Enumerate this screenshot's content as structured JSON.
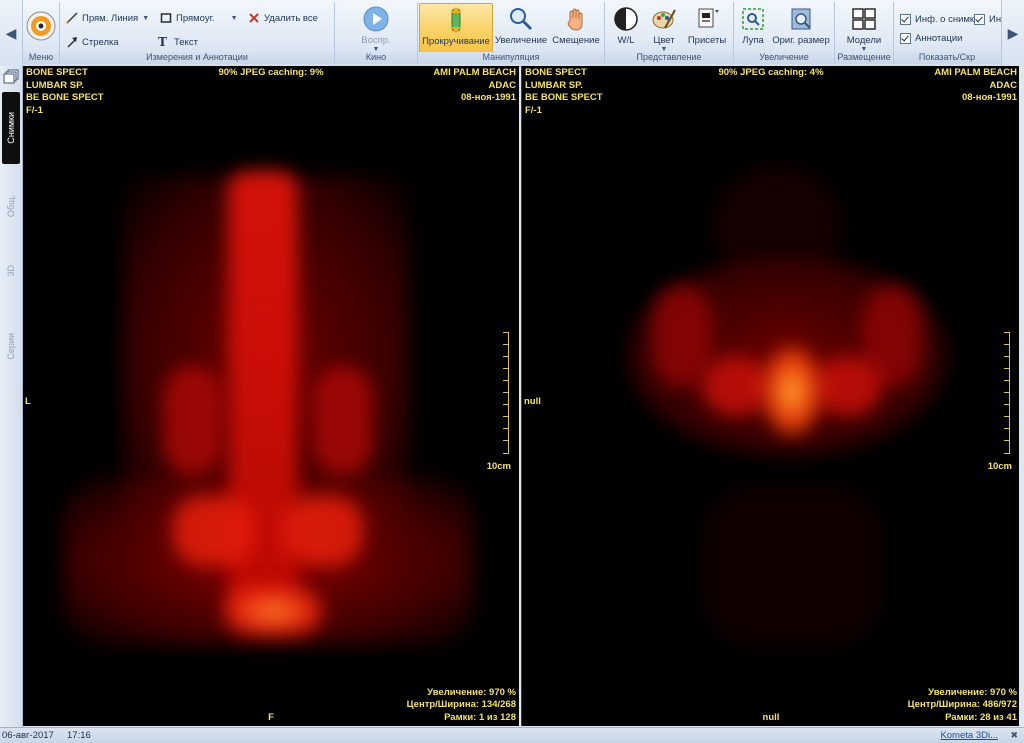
{
  "ribbon": {
    "menu": {
      "label": "Меню"
    },
    "measure": {
      "group_label": "Измерения и Аннотации",
      "line_label": "Прям. Линия",
      "rect_label": "Прямоуг.",
      "delete_all_label": "Удалить все",
      "arrow_label": "Стрелка",
      "text_label": "Текст"
    },
    "cine": {
      "group_label": "Кино",
      "play_label": "Воспр."
    },
    "manip": {
      "group_label": "Манипуляция",
      "scroll_label": "Прокручивание",
      "zoom_label": "Увеличение",
      "pan_label": "Смещение"
    },
    "present": {
      "group_label": "Представление",
      "wl_label": "W/L",
      "color_label": "Цвет",
      "presets_label": "Присеты"
    },
    "magnify": {
      "group_label": "Увеличение",
      "loupe_label": "Лупа",
      "orig_label": "Ориг. размер"
    },
    "layout": {
      "group_label": "Размещение",
      "models_label": "Модели"
    },
    "show": {
      "group_label": "Показать/Скр",
      "info_label": "Инф. о снимке",
      "info2_label": "Ин",
      "annot_label": "Аннотации"
    }
  },
  "left_tabs": {
    "active": "Снимки",
    "t2": "Общ.",
    "t3": "3D",
    "t4": "Серии"
  },
  "viewports": [
    {
      "tl": [
        "BONE SPECT",
        "LUMBAR SP.",
        "BE BONE SPECT",
        "F/-1"
      ],
      "tc": "90% JPEG caching: 9%",
      "tr": [
        "AMI PALM BEACH",
        "ADAC",
        "08-ноя-1991"
      ],
      "left_marker": "L",
      "bottom_marker": "F",
      "scale": "10cm",
      "br": [
        "Увеличение: 970 %",
        "Центр/Ширина: 134/268",
        "Рамки: 1 из 128"
      ]
    },
    {
      "tl": [
        "BONE SPECT",
        "LUMBAR SP.",
        "BE BONE SPECT",
        "F/-1"
      ],
      "tc": "90% JPEG caching: 4%",
      "tr": [
        "AMI PALM BEACH",
        "ADAC",
        "08-ноя-1991"
      ],
      "left_marker": "null",
      "bottom_marker": "null",
      "scale": "10cm",
      "br": [
        "Увеличение: 970 %",
        "Центр/Ширина: 486/972",
        "Рамки: 28 из 41"
      ]
    }
  ],
  "status": {
    "date": "06-авг-2017",
    "time": "17:16",
    "app": "Kometa 3Di..."
  },
  "colors": {
    "overlay_text": "#f3e16a",
    "active_button": "#fbd46b",
    "viewport_divider": "#c40000"
  }
}
